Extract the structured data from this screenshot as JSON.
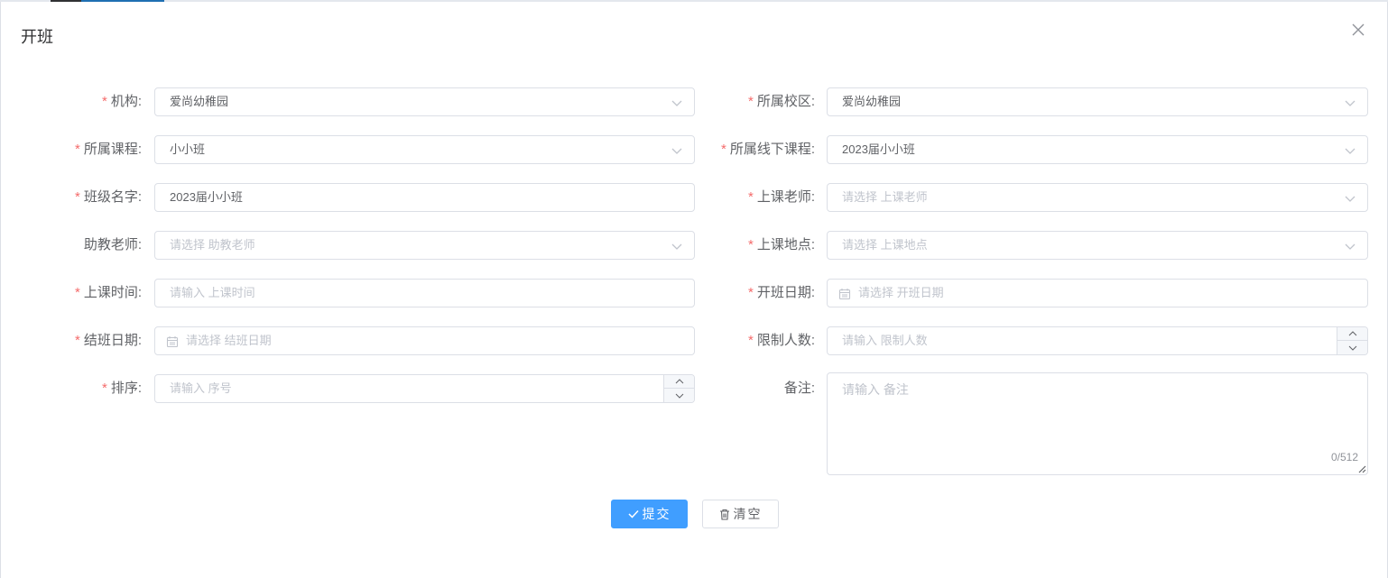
{
  "dialog": {
    "title": "开班"
  },
  "form": {
    "institution": {
      "label": "机构:",
      "value": "爱尚幼稚园"
    },
    "campus": {
      "label": "所属校区:",
      "value": "爱尚幼稚园"
    },
    "course": {
      "label": "所属课程:",
      "value": "小小班"
    },
    "offline_course": {
      "label": "所属线下课程:",
      "value": "2023届小小班"
    },
    "class_name": {
      "label": "班级名字:",
      "value": "2023届小小班"
    },
    "teacher": {
      "label": "上课老师:",
      "placeholder": "请选择 上课老师"
    },
    "assistant": {
      "label": "助教老师:",
      "placeholder": "请选择 助教老师"
    },
    "location": {
      "label": "上课地点:",
      "placeholder": "请选择 上课地点"
    },
    "class_time": {
      "label": "上课时间:",
      "placeholder": "请输入 上课时间"
    },
    "start_date": {
      "label": "开班日期:",
      "placeholder": "请选择 开班日期"
    },
    "end_date": {
      "label": "结班日期:",
      "placeholder": "请选择 结班日期"
    },
    "limit": {
      "label": "限制人数:",
      "placeholder": "请输入 限制人数"
    },
    "sort": {
      "label": "排序:",
      "placeholder": "请输入 序号"
    },
    "remark": {
      "label": "备注:",
      "placeholder": "请输入 备注",
      "counter": "0/512"
    },
    "required_mark": "*"
  },
  "actions": {
    "submit_label": "提交",
    "clear_label": "清空"
  },
  "colors": {
    "primary": "#409eff",
    "required": "#f56c6c",
    "border": "#dcdfe6",
    "placeholder": "#c0c4cc"
  }
}
